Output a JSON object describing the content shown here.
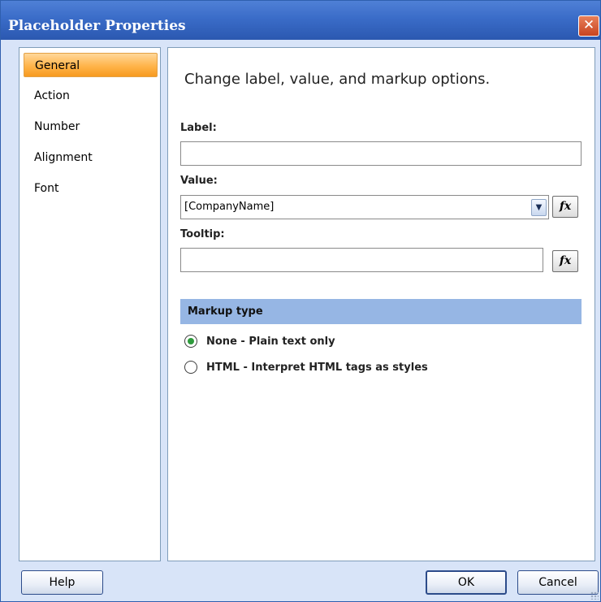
{
  "window": {
    "title": "Placeholder Properties",
    "close_glyph": "✕"
  },
  "nav": {
    "items": [
      {
        "label": "General",
        "active": true
      },
      {
        "label": "Action",
        "active": false
      },
      {
        "label": "Number",
        "active": false
      },
      {
        "label": "Alignment",
        "active": false
      },
      {
        "label": "Font",
        "active": false
      }
    ]
  },
  "main": {
    "heading": "Change label, value, and markup options.",
    "label_field": {
      "label": "Label:",
      "value": ""
    },
    "value_field": {
      "label": "Value:",
      "value": "[CompanyName]",
      "arrow_glyph": "▼",
      "fx_label": "fx"
    },
    "tooltip_field": {
      "label": "Tooltip:",
      "value": "",
      "fx_label": "fx"
    },
    "markup": {
      "header": "Markup type",
      "options": [
        {
          "label": "None - Plain text only",
          "checked": true
        },
        {
          "label": "HTML - Interpret HTML tags as styles",
          "checked": false
        }
      ]
    }
  },
  "footer": {
    "help_label": "Help",
    "ok_label": "OK",
    "cancel_label": "Cancel"
  },
  "colors": {
    "title_bar": "#3a6cc8",
    "active_nav": "#ffb44a",
    "section_header": "#96b6e4",
    "radio_checked": "#2e9a3c"
  },
  "icons": {
    "close": "close-icon",
    "dropdown": "chevron-down-icon",
    "function": "fx-icon"
  }
}
